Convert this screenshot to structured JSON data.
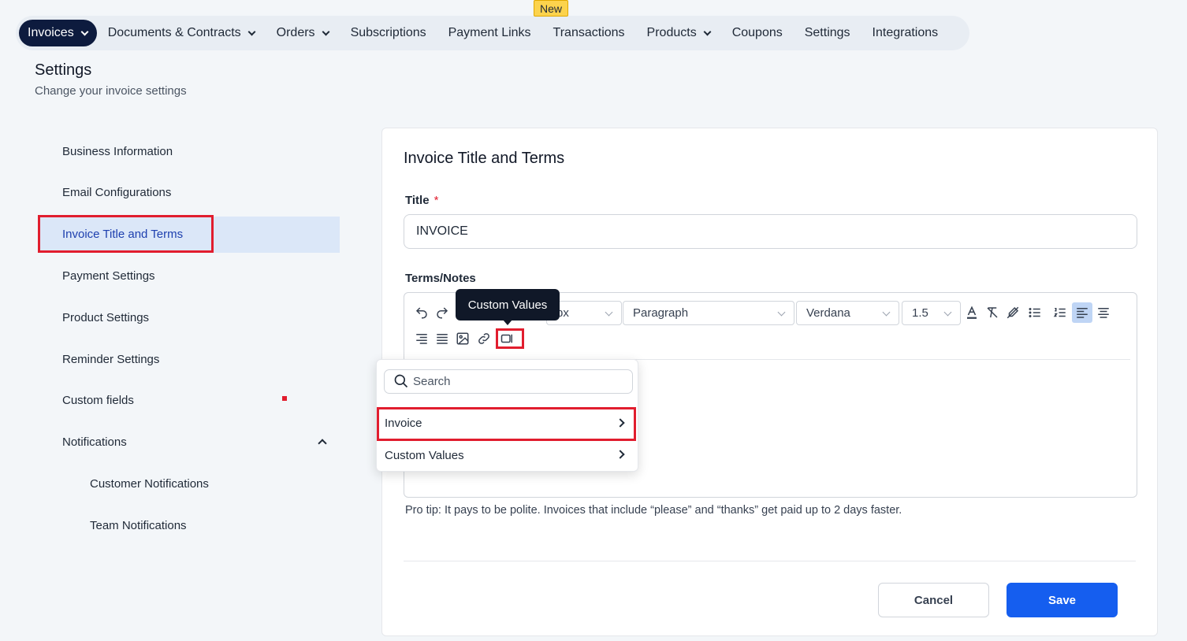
{
  "nav": {
    "items": [
      {
        "label": "Invoices",
        "dropdown": true,
        "active": true
      },
      {
        "label": "Documents & Contracts",
        "dropdown": true
      },
      {
        "label": "Orders",
        "dropdown": true
      },
      {
        "label": "Subscriptions",
        "dropdown": false
      },
      {
        "label": "Payment Links",
        "dropdown": false
      },
      {
        "label": "Transactions",
        "dropdown": false
      },
      {
        "label": "Products",
        "dropdown": true
      },
      {
        "label": "Coupons",
        "dropdown": false
      },
      {
        "label": "Settings",
        "dropdown": false
      },
      {
        "label": "Integrations",
        "dropdown": false
      }
    ],
    "new_badge": "New"
  },
  "header": {
    "title": "Settings",
    "subtitle": "Change your invoice settings"
  },
  "sidebar": {
    "items": [
      {
        "label": "Business Information"
      },
      {
        "label": "Email Configurations"
      },
      {
        "label": "Invoice Title and Terms"
      },
      {
        "label": "Payment Settings"
      },
      {
        "label": "Product Settings"
      },
      {
        "label": "Reminder Settings"
      },
      {
        "label": "Custom fields"
      },
      {
        "label": "Notifications"
      },
      {
        "label": "Customer Notifications"
      },
      {
        "label": "Team Notifications"
      }
    ],
    "active_index": 2
  },
  "card": {
    "title": "Invoice Title and Terms",
    "title_label": "Title",
    "required_mark": "*",
    "title_value": "INVOICE",
    "terms_label": "Terms/Notes",
    "toolbar": {
      "font_size": "px",
      "block_format": "Paragraph",
      "font_family": "Verdana",
      "line_height": "1.5"
    },
    "pro_tip": "Pro tip: It pays to be polite. Invoices that include “please” and “thanks” get paid up to 2 days faster.",
    "cancel_label": "Cancel",
    "save_label": "Save"
  },
  "tooltip": {
    "text": "Custom Values"
  },
  "dropdown": {
    "search_placeholder": "Search",
    "items": [
      {
        "label": "Invoice"
      },
      {
        "label": "Custom Values"
      }
    ]
  },
  "colors": {
    "accent": "#155eef",
    "nav_active": "#0d1b3e",
    "highlight": "#e11d2e",
    "sidebar_active_bg": "#dbe7f8"
  }
}
